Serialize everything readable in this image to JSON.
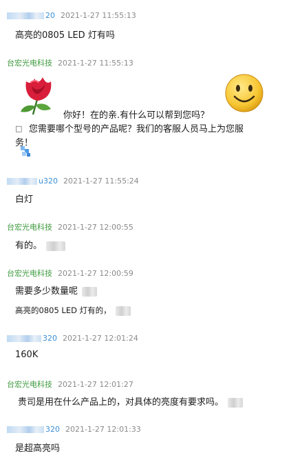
{
  "messages": [
    {
      "sender": "20",
      "sender_type": "customer",
      "time": "2021-1-27 11:55:13",
      "text": "高亮的0805 LED 灯有吗"
    },
    {
      "sender": "台宏光电科技",
      "sender_type": "staff",
      "time": "2021-1-27 11:55:13",
      "line1": "你好！在的亲.有什么可以帮到您吗？",
      "line2": "您需要哪个型号的产品呢？我们的客服人员马上为您服",
      "line3": "务！"
    },
    {
      "sender": "u320",
      "sender_type": "customer",
      "time": "2021-1-27 11:55:24",
      "text": "白灯"
    },
    {
      "sender": "台宏光电科技",
      "sender_type": "staff",
      "time": "2021-1-27 12:00:55",
      "text": "有的。"
    },
    {
      "sender": "台宏光电科技",
      "sender_type": "staff",
      "time": "2021-1-27 12:00:59",
      "text": "需要多少数量呢",
      "text2": "高亮的0805 LED 灯有的，"
    },
    {
      "sender": "320",
      "sender_type": "customer",
      "time": "2021-1-27 12:01:24",
      "text": "160K"
    },
    {
      "sender": "台宏光电科技",
      "sender_type": "staff",
      "time": "2021-1-27 12:01:27",
      "text": "贵司是用在什么产品上的，对具体的亮度有要求吗。"
    },
    {
      "sender": "320",
      "sender_type": "customer",
      "time": "2021-1-27 12:01:33",
      "text": "是超高亮吗"
    }
  ],
  "icons": [
    "rose-emoji-icon",
    "smiley-emoji-icon"
  ],
  "colors": {
    "customer_name": "#3b8fd6",
    "staff_name": "#3e9a3e",
    "timestamp": "#8a8a8a"
  }
}
